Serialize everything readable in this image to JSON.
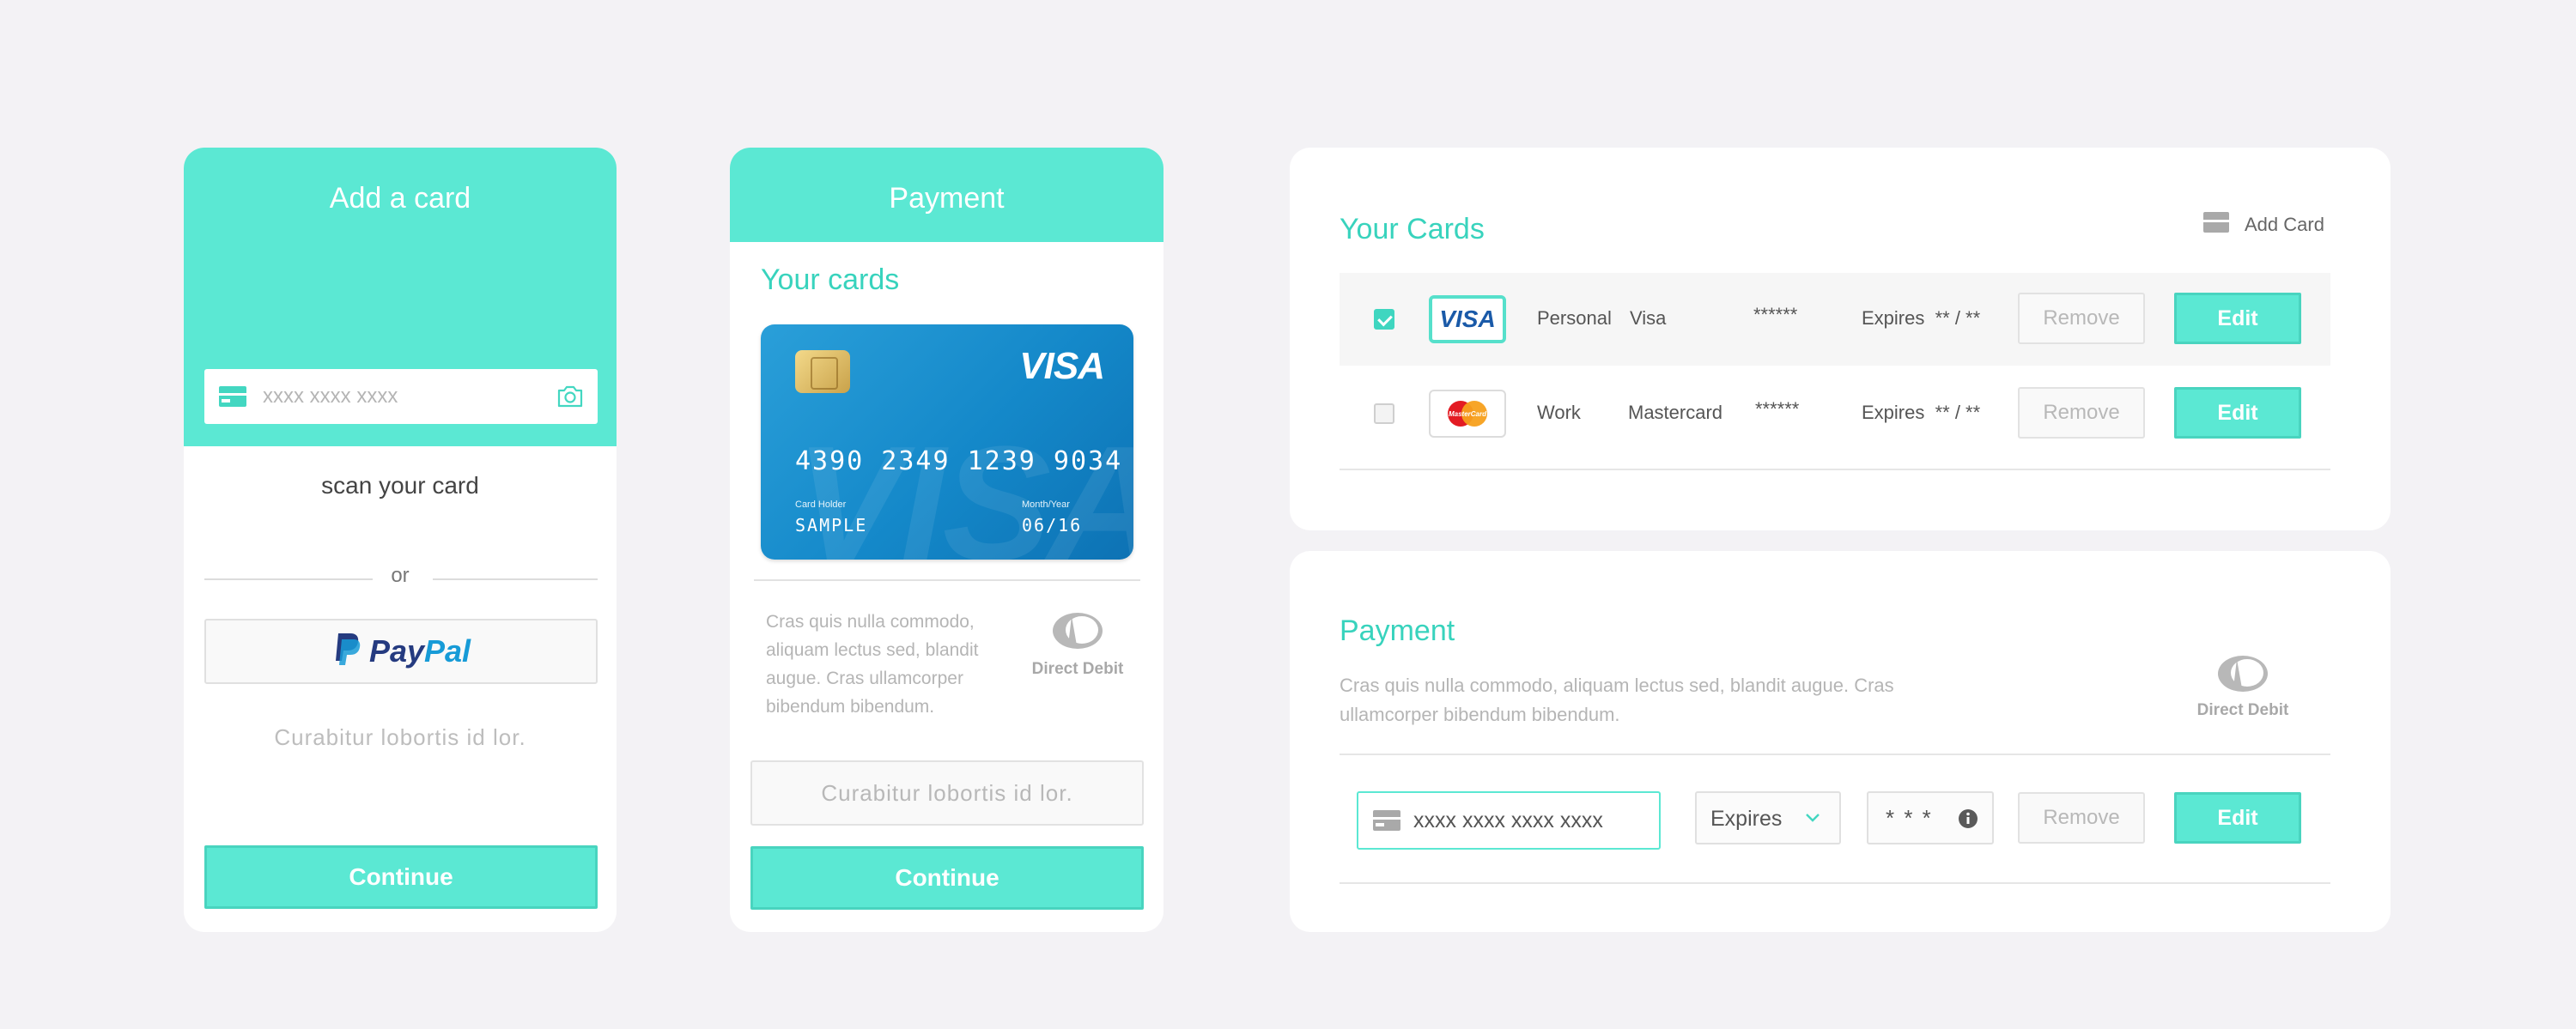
{
  "add_card": {
    "title": "Add a card",
    "card_input_placeholder": "xxxx xxxx xxxx",
    "scan_text": "scan your card",
    "or_text": "or",
    "paypal_label_1": "Pay",
    "paypal_label_2": "Pal",
    "note": "Curabitur lobortis id lor.",
    "continue_label": "Continue"
  },
  "payment_mobile": {
    "title": "Payment",
    "your_cards_label": "Your cards",
    "card": {
      "brand": "VISA",
      "watermark": "VISA",
      "number": "4390 2349 1239 9034",
      "holder_label": "Card Holder",
      "holder": "SAMPLE",
      "expiry_label": "Month/Year",
      "expiry": "06/16"
    },
    "description": "Cras quis nulla commodo, aliquam lectus sed, blandit augue. Cras ullamcorper bibendum bibendum.",
    "direct_debit_label": "Direct Debit",
    "note_button": "Curabitur lobortis id lor.",
    "continue_label": "Continue"
  },
  "your_cards": {
    "title": "Your Cards",
    "add_card_label": "Add Card",
    "rows": [
      {
        "selected": true,
        "brand": "VISA",
        "type": "Personal",
        "network": "Visa",
        "masked": "******",
        "expires": "Expires  ** / **",
        "remove_label": "Remove",
        "edit_label": "Edit"
      },
      {
        "selected": false,
        "brand": "MasterCard",
        "type": "Work",
        "network": "Mastercard",
        "masked": "******",
        "expires": "Expires  ** / **",
        "remove_label": "Remove",
        "edit_label": "Edit"
      }
    ]
  },
  "payment_desktop": {
    "title": "Payment",
    "description": "Cras quis nulla commodo, aliquam lectus sed, blandit augue. Cras ullamcorper bibendum bibendum.",
    "direct_debit_label": "Direct Debit",
    "card_number_value": "xxxx xxxx xxxx xxxx",
    "expires_label": "Expires",
    "cvv_value": "* * *",
    "remove_label": "Remove",
    "edit_label": "Edit"
  },
  "colors": {
    "accent": "#5be8d3",
    "accent_text": "#38d3bd",
    "background": "#f3f2f5",
    "card_blue": "#1488c9"
  },
  "icons": [
    "card-icon",
    "camera-icon",
    "paypal-logo",
    "visa-logo",
    "mastercard-logo",
    "direct-debit-icon",
    "chevron-down-icon",
    "info-icon",
    "checkbox-icon"
  ]
}
